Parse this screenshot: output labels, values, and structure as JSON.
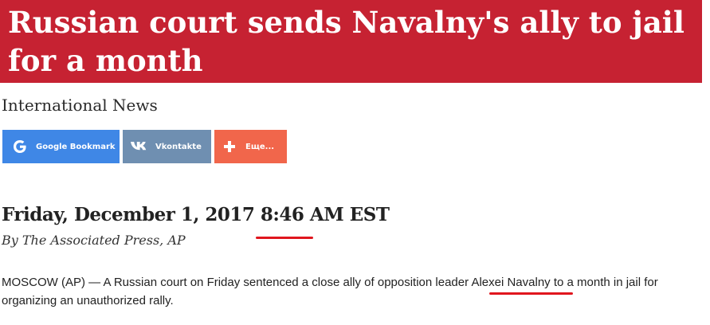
{
  "article": {
    "headline": "Russian court sends Navalny's ally to jail for a month",
    "section": "International News",
    "dateline": "Friday, December 1, 2017 8:46 AM EST",
    "byline": "By The Associated Press, AP",
    "body_part1": "MOSCOW (AP) — A Russian court on Friday sentenced a close ally of opposition leader ",
    "body_name": "Alexei Navalny",
    "body_part2": " to a month in jail for organizing an unauthorized rally."
  },
  "share": {
    "google_label": "Google Bookmark",
    "vk_label": "Vkontakte",
    "more_label": "Еще...",
    "google_icon": "google-g-icon",
    "vk_icon": "vk-logo-icon",
    "more_icon": "plus-icon"
  },
  "colors": {
    "headline_bg": "#c62232",
    "google": "#3f87e6",
    "vk": "#6f8fb1",
    "more": "#f1664b",
    "annotation": "#e0161e"
  }
}
